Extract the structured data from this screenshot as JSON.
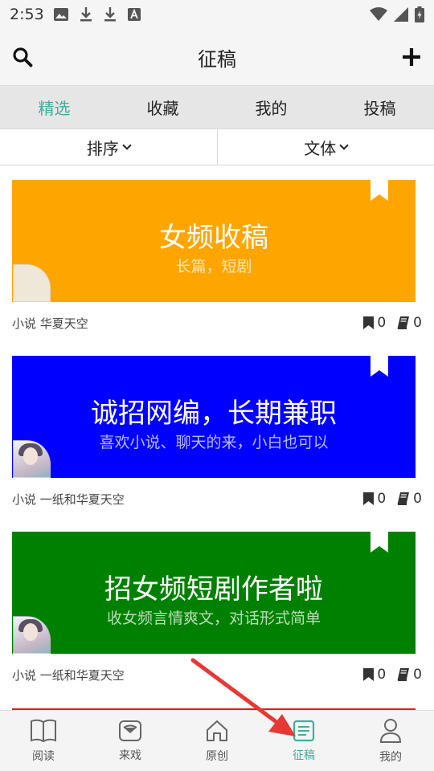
{
  "status_bar": {
    "time": "2:53"
  },
  "header": {
    "title": "征稿"
  },
  "tabs": [
    {
      "label": "精选",
      "active": true
    },
    {
      "label": "收藏",
      "active": false
    },
    {
      "label": "我的",
      "active": false
    },
    {
      "label": "投稿",
      "active": false
    }
  ],
  "filters": {
    "sort_label": "排序",
    "genre_label": "文体"
  },
  "cards": [
    {
      "title": "女频收稿",
      "subtitle": "长篇，短剧",
      "color": "#ffa500",
      "tags": "小说 华夏天空",
      "bookmarks": "0",
      "books": "0"
    },
    {
      "title": "诚招网编，长期兼职",
      "subtitle": "喜欢小说、聊天的来，小白也可以",
      "color": "#0000ff",
      "tags": "小说 一纸和华夏天空",
      "bookmarks": "0",
      "books": "0"
    },
    {
      "title": "招女频短剧作者啦",
      "subtitle": "收女频言情爽文，对话形式简单",
      "color": "#008000",
      "tags": "小说 一纸和华夏天空",
      "bookmarks": "0",
      "books": "0"
    }
  ],
  "bottom_nav": [
    {
      "label": "阅读",
      "icon": "book-icon",
      "active": false
    },
    {
      "label": "来戏",
      "icon": "inbox-icon",
      "active": false
    },
    {
      "label": "原创",
      "icon": "home-icon",
      "active": false
    },
    {
      "label": "征稿",
      "icon": "document-icon",
      "active": true
    },
    {
      "label": "我的",
      "icon": "user-icon",
      "active": false
    }
  ],
  "colors": {
    "accent": "#3fae9a",
    "arrow": "#e53935"
  }
}
